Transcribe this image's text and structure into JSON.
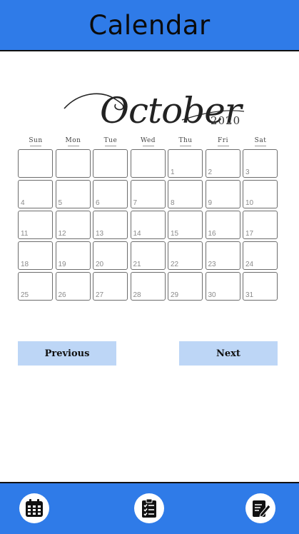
{
  "header": {
    "title": "Calendar"
  },
  "calendar": {
    "month": "October",
    "year": "2020",
    "weekdays": [
      "Sun",
      "Mon",
      "Tue",
      "Wed",
      "Thu",
      "Fri",
      "Sat"
    ],
    "weeks": [
      [
        "",
        "",
        "",
        "",
        "1",
        "2",
        "3"
      ],
      [
        "4",
        "5",
        "6",
        "7",
        "8",
        "9",
        "10"
      ],
      [
        "11",
        "12",
        "13",
        "14",
        "15",
        "16",
        "17"
      ],
      [
        "18",
        "19",
        "20",
        "21",
        "22",
        "23",
        "24"
      ],
      [
        "25",
        "26",
        "27",
        "28",
        "29",
        "30",
        "31"
      ]
    ]
  },
  "navigation": {
    "previous_label": "Previous",
    "next_label": "Next"
  },
  "bottom_nav": {
    "items": [
      {
        "icon": "calendar-icon"
      },
      {
        "icon": "clipboard-checklist-icon"
      },
      {
        "icon": "edit-document-icon"
      }
    ]
  },
  "colors": {
    "bar": "#2f7be8",
    "button": "#bdd6f6",
    "cell_border": "#6d6d6d"
  }
}
